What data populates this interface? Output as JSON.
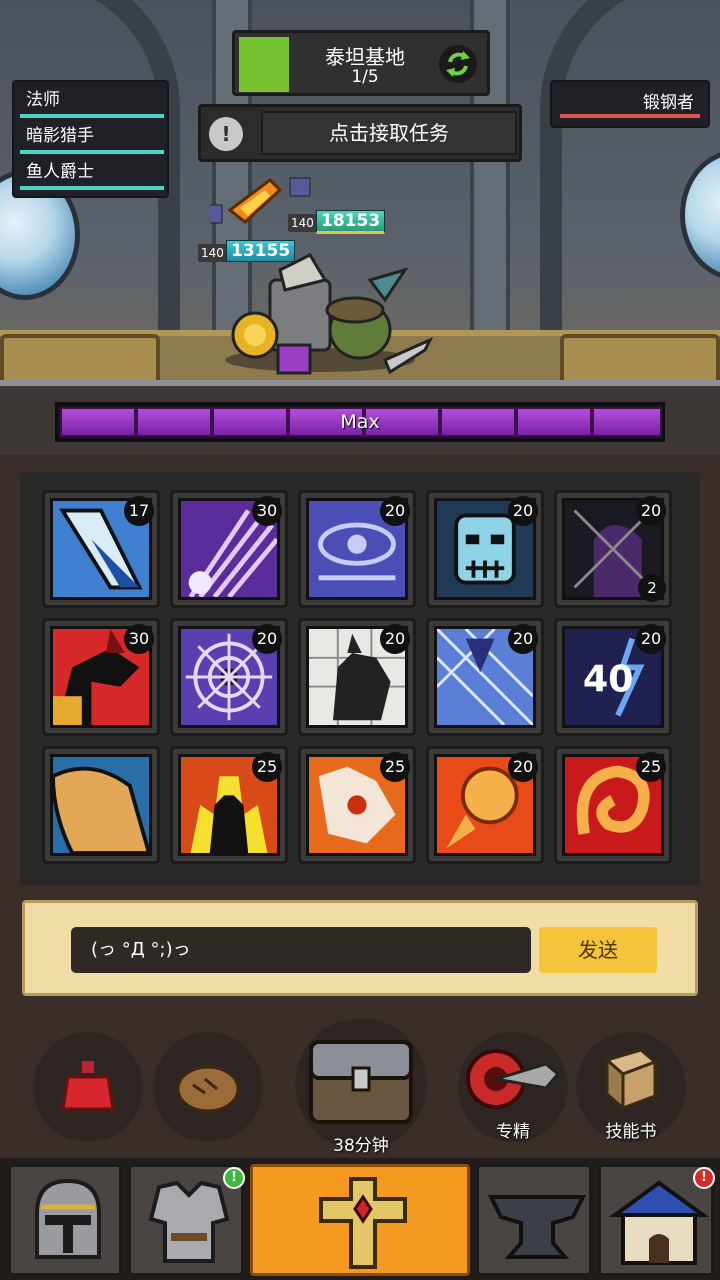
{
  "stage": {
    "name": "泰坦基地",
    "progress": "1/5",
    "progress_fraction": 0.2
  },
  "quest": {
    "label": "点击接取任务"
  },
  "party": [
    {
      "name": "法师"
    },
    {
      "name": "暗影猎手"
    },
    {
      "name": "鱼人爵士"
    }
  ],
  "enemy": {
    "name": "锻钢者"
  },
  "damage_numbers": [
    {
      "level": "140",
      "value": "18153"
    },
    {
      "level": "140",
      "value": "13155"
    }
  ],
  "rage": {
    "label": "Max",
    "segments": 8
  },
  "skills": [
    {
      "name": "ice-spear-skill",
      "level": "17",
      "count": ""
    },
    {
      "name": "shadow-slash-skill",
      "level": "30",
      "count": ""
    },
    {
      "name": "arcane-eye-skill",
      "level": "20",
      "count": ""
    },
    {
      "name": "frost-skull-skill",
      "level": "20",
      "count": ""
    },
    {
      "name": "shadow-cloak-skill",
      "level": "20",
      "count": "2"
    },
    {
      "name": "dragon-roar-skill",
      "level": "30",
      "count": ""
    },
    {
      "name": "void-web-skill",
      "level": "20",
      "count": ""
    },
    {
      "name": "stone-cat-skill",
      "level": "20",
      "count": ""
    },
    {
      "name": "crystal-shard-skill",
      "level": "20",
      "count": ""
    },
    {
      "name": "storm-40-skill",
      "level": "20",
      "count": "",
      "overlay": "40"
    },
    {
      "name": "earth-shell-skill",
      "level": "",
      "count": ""
    },
    {
      "name": "fire-aura-skill",
      "level": "25",
      "count": ""
    },
    {
      "name": "flame-beast-skill",
      "level": "25",
      "count": ""
    },
    {
      "name": "fire-orb-skill",
      "level": "20",
      "count": ""
    },
    {
      "name": "fire-spiral-skill",
      "level": "25",
      "count": ""
    }
  ],
  "chat": {
    "input_value": "(っ °Д °;)っ",
    "send_label": "发送"
  },
  "actions": {
    "chest_timer": "38分钟",
    "talent_label": "专精",
    "skillbook_label": "技能书"
  },
  "nav": {
    "tabs": [
      "helmet",
      "armor",
      "relic",
      "anvil",
      "shop"
    ],
    "active": "relic",
    "badges": {
      "armor": "!",
      "shop": "!"
    }
  },
  "colors": {
    "accent": "#f59a20",
    "hp_ally": "#49d3c2",
    "hp_enemy": "#e25050",
    "rage": "#9b35c7",
    "stage_green": "#76c231"
  }
}
